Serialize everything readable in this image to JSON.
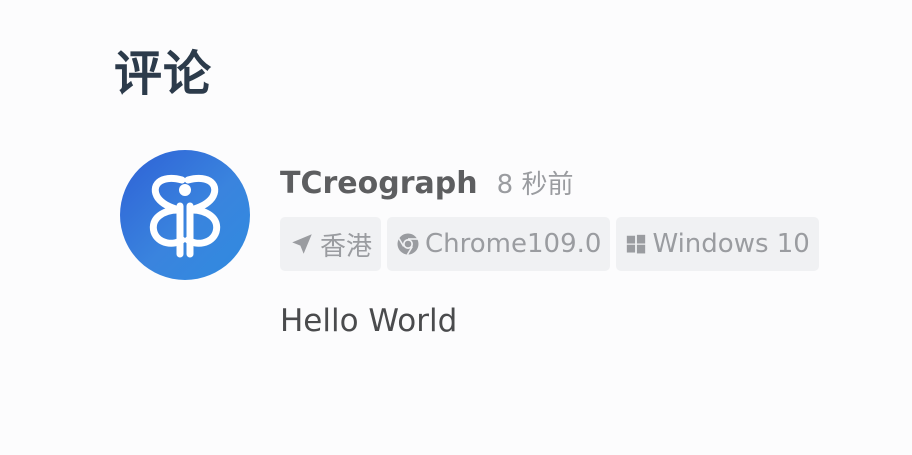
{
  "heading": "评论",
  "comment": {
    "nick": "TCreograph",
    "time": "8 秒前",
    "location": "香港",
    "browser": "Chrome109.0",
    "os": "Windows 10",
    "content": "Hello World"
  },
  "icons": {
    "location": "location-arrow-icon",
    "browser": "chrome-icon",
    "os": "windows-icon"
  },
  "colors": {
    "heading": "#2c3b4b",
    "avatar_bg": "#2e61d6",
    "tag_bg": "#f0f1f3",
    "muted_text": "#9a9ca0"
  }
}
